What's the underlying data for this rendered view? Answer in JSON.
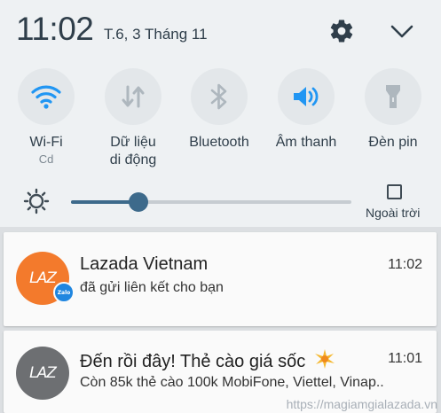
{
  "status_bar": {
    "time": "11:02",
    "date": "T.6, 3 Tháng 11",
    "settings_icon": "gear-icon",
    "expand_icon": "chevron-down-icon"
  },
  "quick_settings": {
    "tiles": [
      {
        "label": "Wi-Fi",
        "sub": "Cd",
        "icon": "wifi-icon",
        "active": true
      },
      {
        "label": "Dữ liệu di động",
        "line1": "Dữ liệu",
        "line2": "di động",
        "icon": "mobile-data-icon",
        "active": false
      },
      {
        "label": "Bluetooth",
        "icon": "bluetooth-icon",
        "active": false
      },
      {
        "label": "Âm thanh",
        "icon": "volume-icon",
        "active": true
      },
      {
        "label": "Đèn pin",
        "icon": "flashlight-icon",
        "active": false
      }
    ],
    "brightness": {
      "level": 0.24,
      "outdoor_label": "Ngoài trời",
      "outdoor_checked": false
    }
  },
  "notifications": [
    {
      "app_icon_text": "LAZ",
      "badge_text": "Zalo",
      "title": "Lazada Vietnam",
      "time": "11:02",
      "body": "đã gửi liên kết cho bạn"
    },
    {
      "app_icon_text": "LAZ",
      "title": "Đến rồi đây! Thẻ cào giá sốc",
      "title_emoji": "sparkle-icon",
      "time": "11:01",
      "body": "Còn 85k thẻ cào 100k MobiFone, Viettel, Vinap.."
    }
  ],
  "watermark": "https://magiamgialazada.vn",
  "colors": {
    "accent": "#2196f3",
    "inactive_icon": "#aeb7be",
    "slider": "#3d6a8b",
    "lazada_orange": "#f37a2c",
    "zalo_blue": "#1f86e0"
  }
}
